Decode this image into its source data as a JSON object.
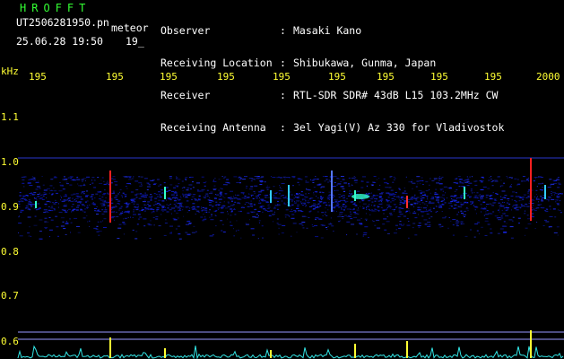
{
  "header": {
    "station": "HROFFT",
    "file": "UT2506281950.pn",
    "mode": "meteor",
    "datetime": "25.06.28 19:50",
    "counter": "19_",
    "labels": [
      "Observer",
      "Receiving Location",
      "Receiver",
      "Receiving Antenna"
    ],
    "colons": [
      ":",
      ":",
      ":",
      ":"
    ],
    "values": [
      "Masaki Kano",
      "Shibukawa, Gunma, Japan",
      "RTL-SDR SDR# 43dB L15 103.2MHz CW",
      "3el Yagi(V) Az 330 for Vladivostok"
    ]
  },
  "axis": {
    "unit": "kHz",
    "freq_ticks": [
      {
        "label": "1.1",
        "value": 1.1
      },
      {
        "label": "1.0",
        "value": 1.0
      },
      {
        "label": "0.9",
        "value": 0.9
      },
      {
        "label": "0.8",
        "value": 0.8
      },
      {
        "label": "0.7",
        "value": 0.7
      },
      {
        "label": "0.6",
        "value": 0.6
      }
    ],
    "time_ticks": [
      "195",
      "195",
      "195",
      "195",
      "195",
      "195",
      "195",
      "195",
      "195",
      "2000"
    ]
  },
  "colors": {
    "background": "#000000",
    "header_text": "#ffffff",
    "header_values": "#ffff33",
    "station": "#33ff33",
    "noise": "#1a2aff",
    "signal_strong": "#ff2020",
    "signal_mid": "#33ffcc",
    "baseline": "#9999ff",
    "amplitude": "#33e6e6"
  }
}
